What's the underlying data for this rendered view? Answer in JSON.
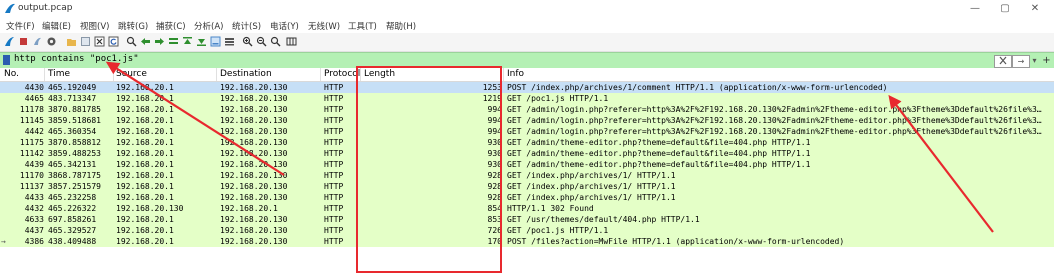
{
  "window": {
    "title": "output.pcap",
    "controls": [
      "—",
      "▢",
      "✕"
    ]
  },
  "menu": [
    "文件(F)",
    "编辑(E)",
    "视图(V)",
    "跳转(G)",
    "捕获(C)",
    "分析(A)",
    "统计(S)",
    "电话(Y)",
    "无线(W)",
    "工具(T)",
    "帮助(H)"
  ],
  "toolbar": {
    "icons": [
      "shark-fin-start-icon",
      "stop-icon",
      "restart-icon",
      "options-gear-icon",
      "open-folder-icon",
      "save-file-icon",
      "close-file-icon",
      "reload-icon",
      "find-magnifier-icon",
      "go-back-icon",
      "go-forward-icon",
      "go-to-packet-icon",
      "go-first-icon",
      "go-last-icon",
      "autoscroll-icon",
      "colorize-icon",
      "zoom-in-icon",
      "zoom-out-icon",
      "zoom-normal-icon",
      "resize-columns-icon"
    ]
  },
  "filter": {
    "value": "http contains \"poc1.js\"",
    "apply_label": "→",
    "dropdown_label": "▾",
    "add_label": "+"
  },
  "columns": [
    "No.",
    "Time",
    "Source",
    "Destination",
    "Protocol",
    "Length",
    "Info"
  ],
  "rows": [
    {
      "no": "4430",
      "time": "465.192049",
      "src": "192.168.20.1",
      "dst": "192.168.20.130",
      "proto": "HTTP",
      "len": "1253",
      "info": "POST /index.php/archives/1/comment HTTP/1.1  (application/x-www-form-urlencoded)",
      "selected": true
    },
    {
      "no": "4465",
      "time": "483.713347",
      "src": "192.168.20.1",
      "dst": "192.168.20.130",
      "proto": "HTTP",
      "len": "1219",
      "info": "GET /poc1.js HTTP/1.1"
    },
    {
      "no": "11178",
      "time": "3870.881785",
      "src": "192.168.20.1",
      "dst": "192.168.20.130",
      "proto": "HTTP",
      "len": "994",
      "info": "GET /admin/login.php?referer=http%3A%2F%2F192.168.20.130%2Fadmin%2Ftheme-editor.php%3Ftheme%3Ddefault%26file%3…"
    },
    {
      "no": "11145",
      "time": "3859.518681",
      "src": "192.168.20.1",
      "dst": "192.168.20.130",
      "proto": "HTTP",
      "len": "994",
      "info": "GET /admin/login.php?referer=http%3A%2F%2F192.168.20.130%2Fadmin%2Ftheme-editor.php%3Ftheme%3Ddefault%26file%3…"
    },
    {
      "no": "4442",
      "time": "465.360354",
      "src": "192.168.20.1",
      "dst": "192.168.20.130",
      "proto": "HTTP",
      "len": "994",
      "info": "GET /admin/login.php?referer=http%3A%2F%2F192.168.20.130%2Fadmin%2Ftheme-editor.php%3Ftheme%3Ddefault%26file%3…"
    },
    {
      "no": "11175",
      "time": "3870.858812",
      "src": "192.168.20.1",
      "dst": "192.168.20.130",
      "proto": "HTTP",
      "len": "930",
      "info": "GET /admin/theme-editor.php?theme=default&file=404.php HTTP/1.1"
    },
    {
      "no": "11142",
      "time": "3859.488253",
      "src": "192.168.20.1",
      "dst": "192.168.20.130",
      "proto": "HTTP",
      "len": "930",
      "info": "GET /admin/theme-editor.php?theme=default&file=404.php HTTP/1.1"
    },
    {
      "no": "4439",
      "time": "465.342131",
      "src": "192.168.20.1",
      "dst": "192.168.20.130",
      "proto": "HTTP",
      "len": "930",
      "info": "GET /admin/theme-editor.php?theme=default&file=404.php HTTP/1.1"
    },
    {
      "no": "11170",
      "time": "3868.787175",
      "src": "192.168.20.1",
      "dst": "192.168.20.130",
      "proto": "HTTP",
      "len": "928",
      "info": "GET /index.php/archives/1/ HTTP/1.1"
    },
    {
      "no": "11137",
      "time": "3857.251579",
      "src": "192.168.20.1",
      "dst": "192.168.20.130",
      "proto": "HTTP",
      "len": "928",
      "info": "GET /index.php/archives/1/ HTTP/1.1"
    },
    {
      "no": "4433",
      "time": "465.232258",
      "src": "192.168.20.1",
      "dst": "192.168.20.130",
      "proto": "HTTP",
      "len": "928",
      "info": "GET /index.php/archives/1/ HTTP/1.1"
    },
    {
      "no": "4432",
      "time": "465.226322",
      "src": "192.168.20.130",
      "dst": "192.168.20.1",
      "proto": "HTTP",
      "len": "854",
      "info": "HTTP/1.1 302 Found"
    },
    {
      "no": "4633",
      "time": "697.858261",
      "src": "192.168.20.1",
      "dst": "192.168.20.130",
      "proto": "HTTP",
      "len": "853",
      "info": "GET /usr/themes/default/404.php HTTP/1.1"
    },
    {
      "no": "4437",
      "time": "465.329527",
      "src": "192.168.20.1",
      "dst": "192.168.20.130",
      "proto": "HTTP",
      "len": "726",
      "info": "GET /poc1.js HTTP/1.1"
    },
    {
      "no": "4386",
      "time": "438.409488",
      "src": "192.168.20.1",
      "dst": "192.168.20.130",
      "proto": "HTTP",
      "len": "170",
      "info": "POST /files?action=MwFile HTTP/1.1  (application/x-www-form-urlencoded)",
      "marker": "→"
    }
  ],
  "colors": {
    "row_green": "#e4ffc7",
    "row_selected": "#c6dff6",
    "filter_bg": "#b4f0b4",
    "annotation_red": "#e8292e"
  }
}
